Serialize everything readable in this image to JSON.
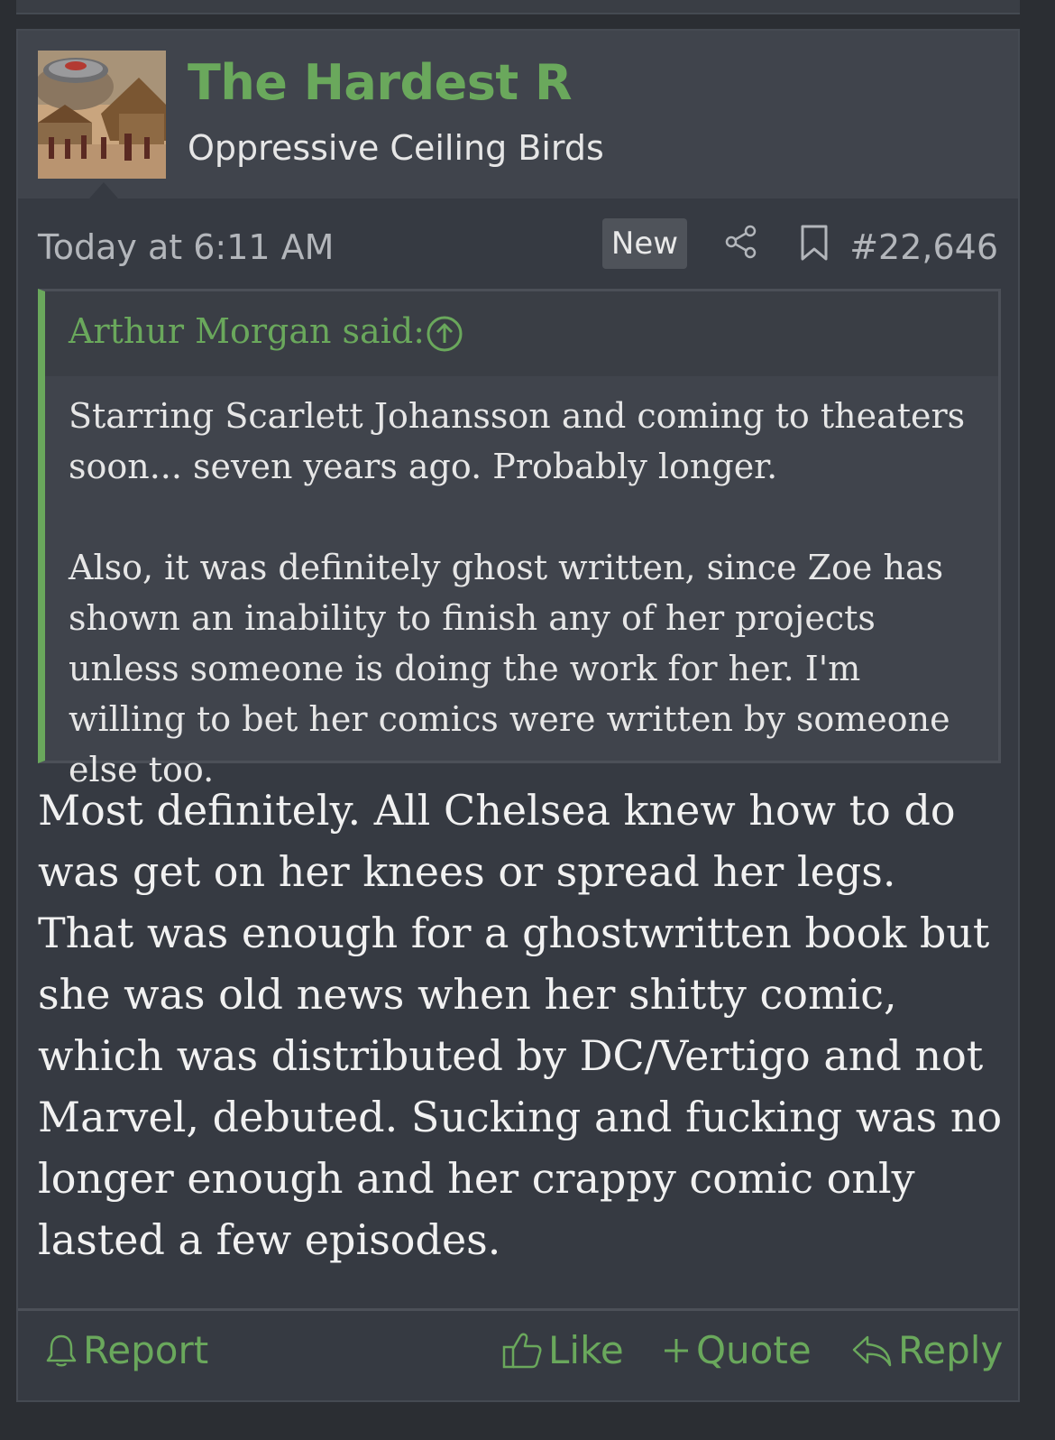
{
  "post": {
    "username": "The Hardest R",
    "user_title": "Oppressive Ceiling Birds",
    "timestamp": "Today at 6:11 AM",
    "new_badge": "New",
    "post_number": "#22,646",
    "quote": {
      "author_line": "Arthur Morgan said:",
      "paragraph_1": "Starring Scarlett Johansson and coming to theaters soon... seven years ago. Probably longer.",
      "paragraph_2": "Also, it was definitely ghost written, since Zoe has shown an inability to finish any of her projects unless someone is doing the work for her. I'm willing to bet her comics were written by someone else too."
    },
    "message": "Most definitely. All Chelsea knew how to do was get on her knees or spread her legs. That was enough for a ghostwritten book but she was old news when her shitty comic, which was distributed by DC/Vertigo and not Marvel, debuted. Sucking and fucking was no longer enough and her crappy comic only lasted a few episodes.",
    "footer": {
      "report": "Report",
      "like": "Like",
      "quote": "Quote",
      "reply": "Reply"
    }
  },
  "icons": {
    "share": "share-icon",
    "bookmark": "bookmark-icon",
    "quote_jump": "arrow-up-circle-icon",
    "report": "bell-icon",
    "like": "thumbs-up-icon",
    "quote": "plus-icon",
    "reply": "reply-arrow-icon"
  },
  "colors": {
    "accent": "#6aa85c",
    "background": "#2b2e33",
    "card": "#363a42",
    "header": "#40444c",
    "text": "#f1f1f1"
  }
}
